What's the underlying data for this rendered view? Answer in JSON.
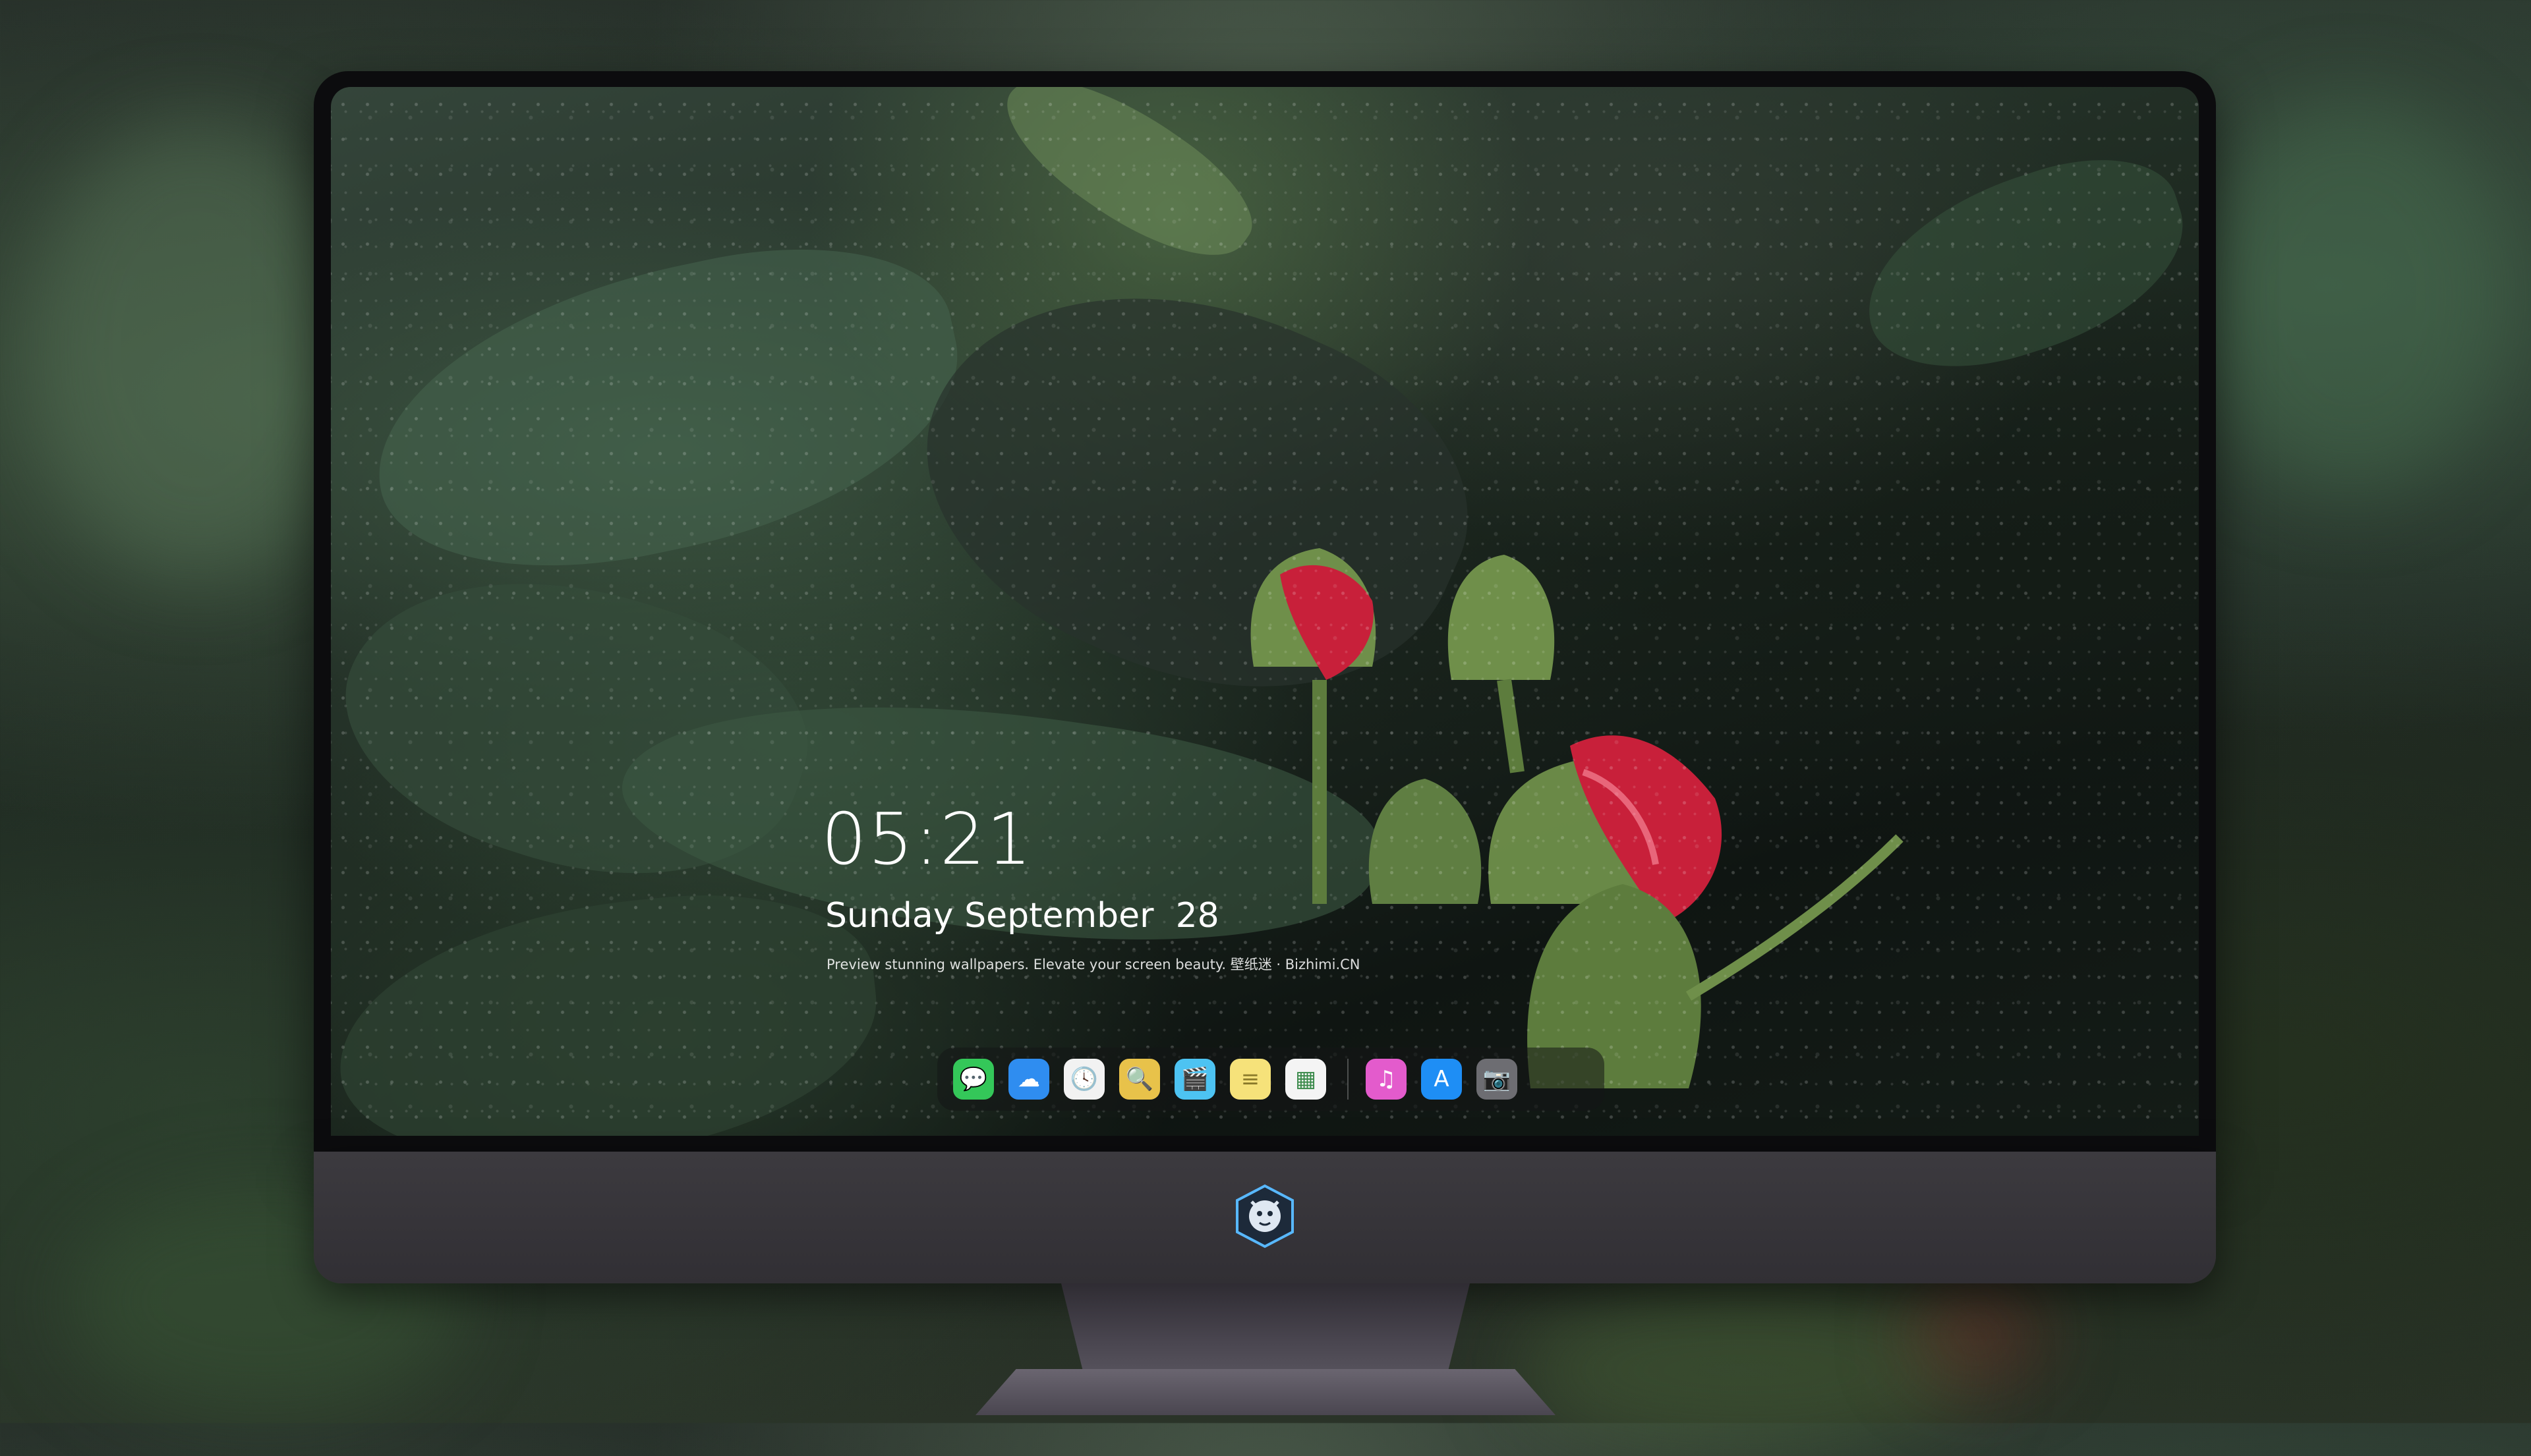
{
  "lockscreen": {
    "time": "05:21",
    "date": "Sunday September  28",
    "caption": "Preview stunning wallpapers. Elevate your screen beauty. 壁纸迷 · Bizhimi.CN"
  },
  "dock": {
    "apps": [
      {
        "name": "messages-icon",
        "glyph": "💬",
        "bg": "#34c759"
      },
      {
        "name": "weather-icon",
        "glyph": "☁",
        "bg": "#2f8df0"
      },
      {
        "name": "clock-icon",
        "glyph": "🕓",
        "bg": "#f2f2f2"
      },
      {
        "name": "preview-icon",
        "glyph": "🔍",
        "bg": "#e8c24a"
      },
      {
        "name": "video-editor-icon",
        "glyph": "🎬",
        "bg": "#4dc3f2"
      },
      {
        "name": "notes-icon",
        "glyph": "≡",
        "bg": "#f6e27a"
      },
      {
        "name": "photos-icon",
        "glyph": "▦",
        "bg": "#f4f4f4"
      },
      {
        "name": "music-icon",
        "glyph": "♫",
        "bg": "#e35bcc"
      },
      {
        "name": "app-store-icon",
        "glyph": "A",
        "bg": "#1e8ef5"
      },
      {
        "name": "camera-icon",
        "glyph": "📷",
        "bg": "#6d6d72"
      }
    ]
  },
  "colors": {
    "chin": "#3c3a3f",
    "bezel": "#0c0c0e",
    "rose": "#c8203a",
    "bud_green": "#6f8f4a"
  }
}
